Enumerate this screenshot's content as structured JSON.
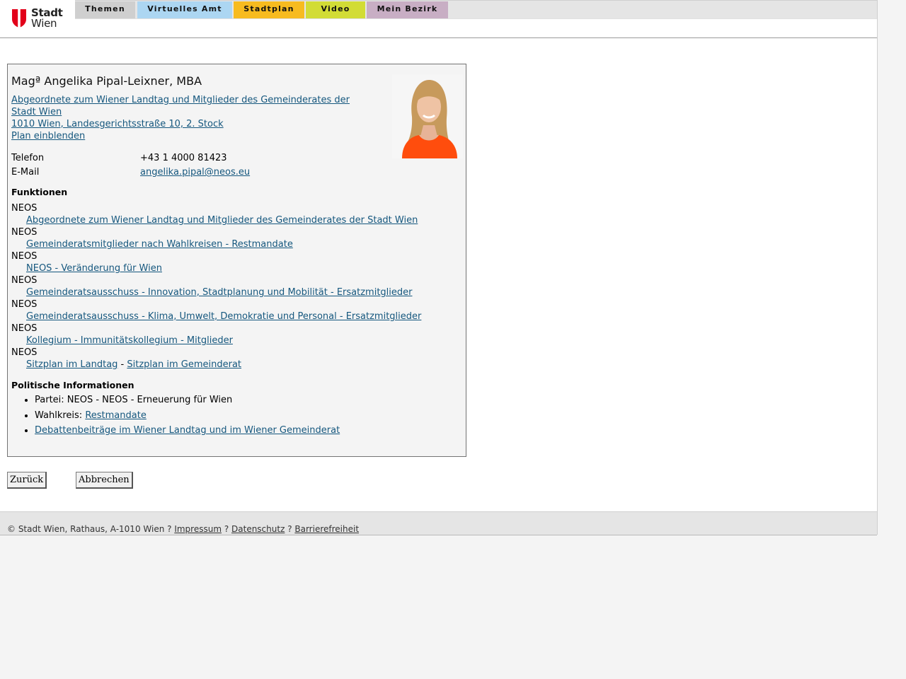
{
  "header": {
    "logo_line1": "Stadt",
    "logo_line2": "Wien",
    "nav": [
      {
        "label": "Themen",
        "color": "#cfcfcf"
      },
      {
        "label": "Virtuelles Amt",
        "color": "#acd6f2"
      },
      {
        "label": "Stadtplan",
        "color": "#f7bb1f"
      },
      {
        "label": "Video",
        "color": "#d2dc35"
      },
      {
        "label": "Mein Bezirk",
        "color": "#c8aec4"
      }
    ]
  },
  "profile": {
    "name": "Magª Angelika Pipal-Leixner, MBA",
    "role_line1": "Abgeordnete zum Wiener Landtag und Mitglieder des Gemeinderates der",
    "role_line2": "Stadt Wien ",
    "address": "1010 Wien, Landesgerichtsstraße 10, 2. Stock",
    "plan_link": "Plan einblenden",
    "phone_label": "Telefon",
    "phone_value": "+43 1 4000 81423",
    "email_label": "E-Mail",
    "email_value": "angelika.pipal@neos.eu"
  },
  "functions": {
    "title": "Funktionen",
    "items": [
      {
        "party": "NEOS",
        "link": "Abgeordnete zum Wiener Landtag und Mitglieder des Gemeinderates der Stadt Wien"
      },
      {
        "party": "NEOS",
        "link": "Gemeinderatsmitglieder nach Wahlkreisen - Restmandate"
      },
      {
        "party": "NEOS",
        "link": "NEOS - Veränderung für Wien"
      },
      {
        "party": "NEOS",
        "link": "Gemeinderatsausschuss - Innovation, Stadtplanung und Mobilität - Ersatzmitglieder"
      },
      {
        "party": "NEOS",
        "link": "Gemeinderatsausschuss - Klima, Umwelt, Demokratie und Personal - Ersatzmitglieder"
      },
      {
        "party": "NEOS",
        "link": "Kollegium - Immunitätskollegium - Mitglieder"
      }
    ],
    "seat_party": "NEOS",
    "seat_landtag": "Sitzplan im Landtag",
    "seat_separator": " - ",
    "seat_gemeinderat": "Sitzplan im Gemeinderat"
  },
  "political": {
    "title": "Politische Informationen",
    "party": "Partei: NEOS - NEOS - Erneuerung für Wien",
    "district_label": "Wahlkreis: ",
    "district_link": "Restmandate",
    "debate_link": "Debattenbeiträge im Wiener Landtag und im Wiener Gemeinderat"
  },
  "buttons": {
    "back": "Zurück",
    "cancel": "Abbrechen"
  },
  "footer": {
    "copyright": "© Stadt Wien, Rathaus, A-1010 Wien ? ",
    "impressum": "Impressum",
    "sep1": " ? ",
    "datenschutz": "Datenschutz",
    "sep2": " ? ",
    "barrierefreiheit": "Barrierefreiheit"
  }
}
